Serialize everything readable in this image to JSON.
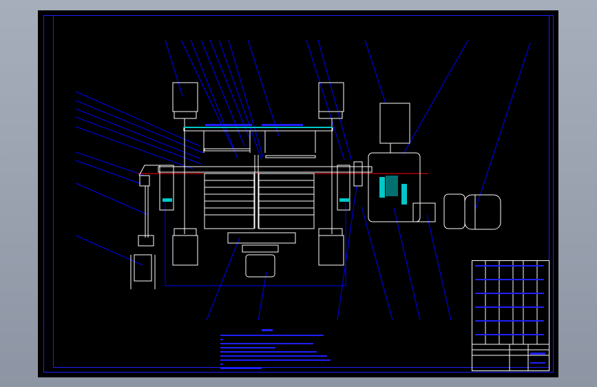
{
  "drawing": {
    "type": "cad-assembly-drawing",
    "background_color": "#000000",
    "line_color": "#ffffff",
    "leader_color": "#0000ff",
    "centerline_color": "#ff0000",
    "section_hatch_color": "#00c8c8"
  }
}
